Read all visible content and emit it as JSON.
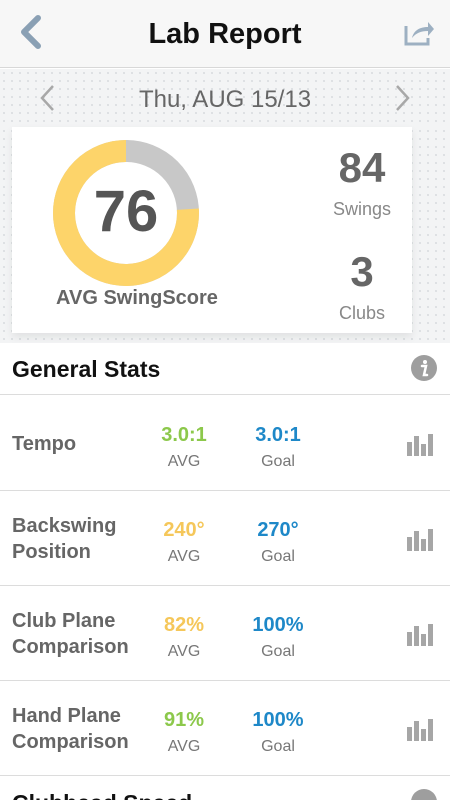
{
  "header": {
    "title": "Lab Report"
  },
  "date": {
    "label": "Thu, AUG 15/13"
  },
  "summary": {
    "score": "76",
    "score_fraction": 0.76,
    "score_label": "AVG SwingScore",
    "swings_value": "84",
    "swings_label": "Swings",
    "clubs_value": "3",
    "clubs_label": "Clubs"
  },
  "general_stats": {
    "title": "General Stats",
    "rows": [
      {
        "name": "Tempo",
        "avg_value": "3.0:1",
        "avg_label": "AVG",
        "goal_value": "3.0:1",
        "goal_label": "Goal",
        "avg_color": "#8cc84b"
      },
      {
        "name": "Backswing Position",
        "avg_value": "240°",
        "avg_label": "AVG",
        "goal_value": "270°",
        "goal_label": "Goal",
        "avg_color": "#f5c75a"
      },
      {
        "name": "Club Plane Comparison",
        "avg_value": "82%",
        "avg_label": "AVG",
        "goal_value": "100%",
        "goal_label": "Goal",
        "avg_color": "#f5c75a"
      },
      {
        "name": "Hand Plane Comparison",
        "avg_value": "91%",
        "avg_label": "AVG",
        "goal_value": "100%",
        "goal_label": "Goal",
        "avg_color": "#8cc84b"
      }
    ]
  },
  "next_section": {
    "title": "Clubhead Speed"
  },
  "colors": {
    "score_fill": "#fdd46a",
    "score_track": "#c8c8c8",
    "goal": "#1e88c8",
    "icon": "#9e9e9e"
  },
  "icons": [
    "back-arrow-icon",
    "share-icon",
    "chevron-left-icon",
    "chevron-right-icon",
    "info-icon",
    "bar-chart-icon"
  ]
}
